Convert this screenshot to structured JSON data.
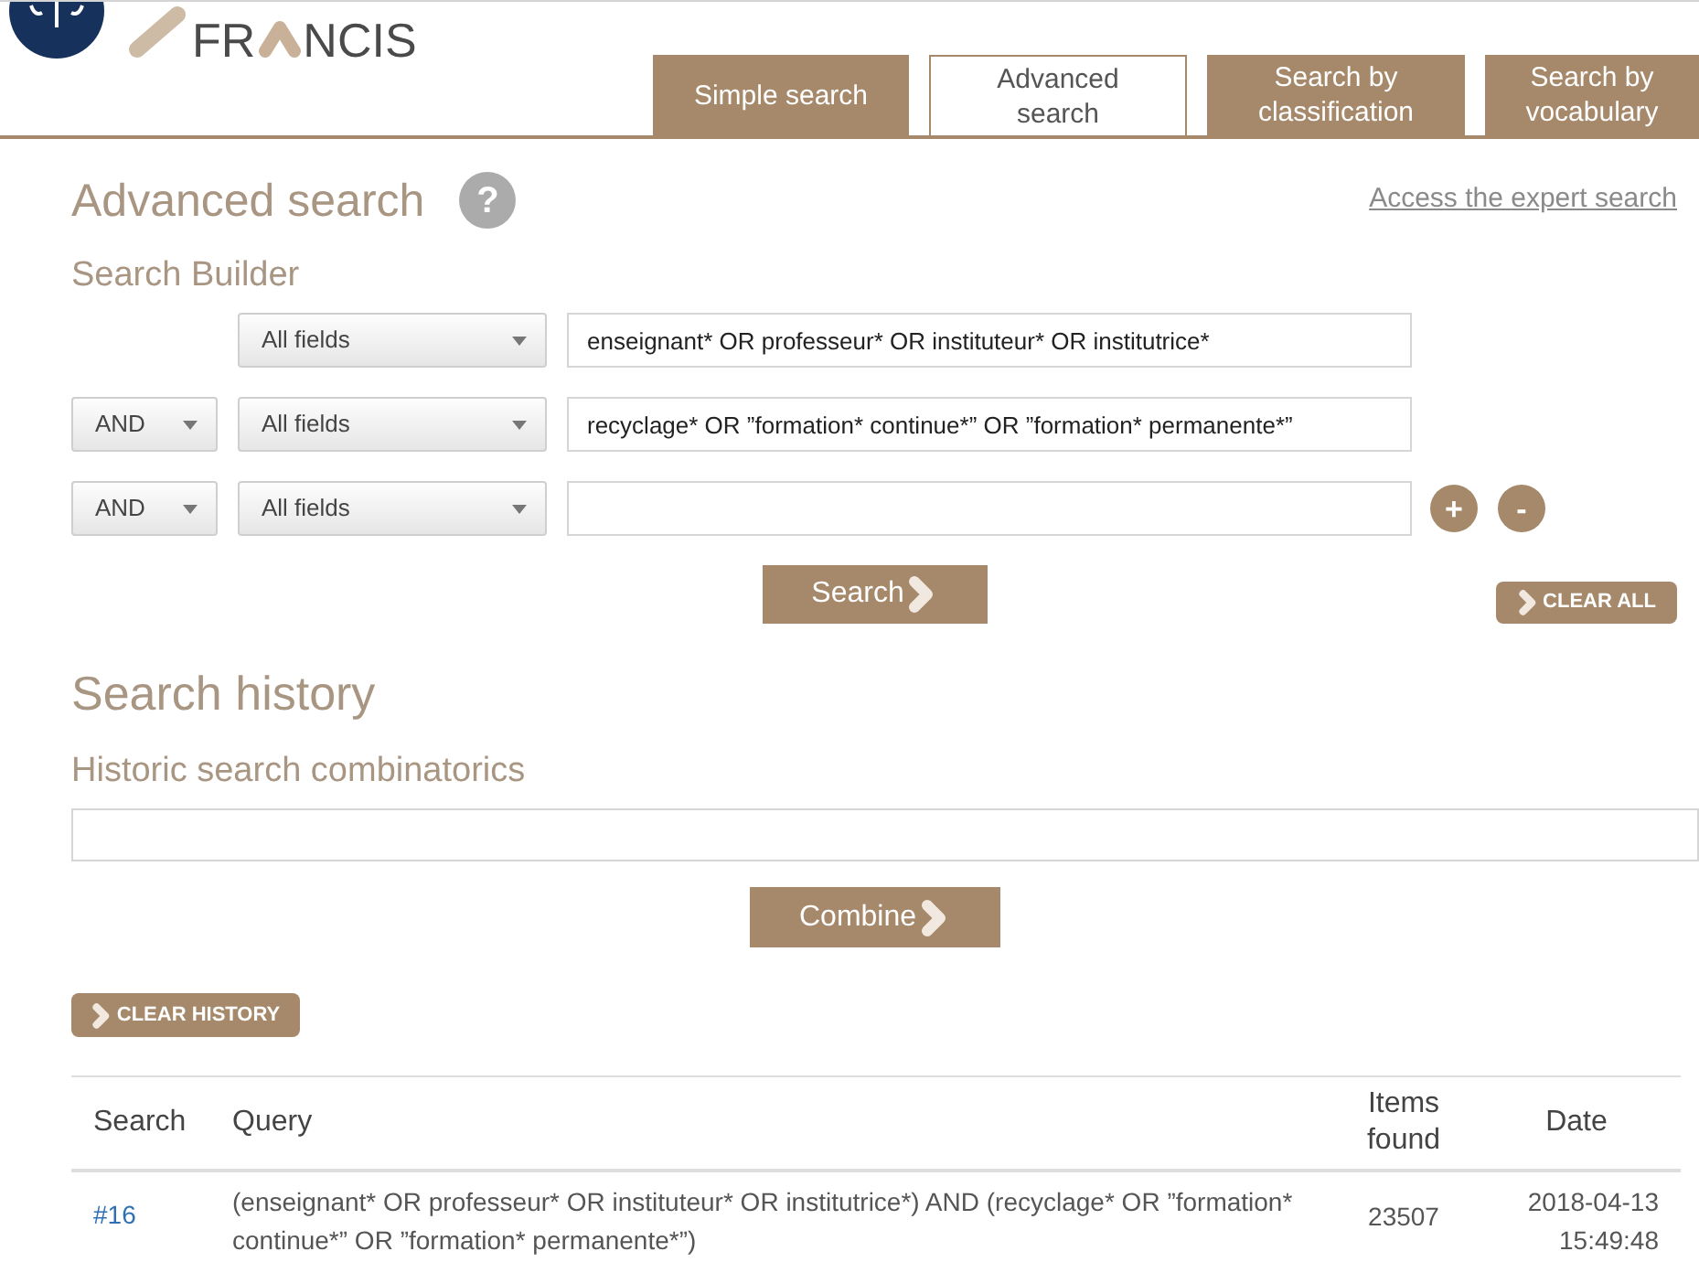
{
  "logo": {
    "text_before": "FR",
    "text_after": "NCIS"
  },
  "tabs": [
    {
      "label": "Simple search",
      "selected": false
    },
    {
      "label": "Advanced search",
      "selected": true
    },
    {
      "label": "Search by classification",
      "selected": false
    },
    {
      "label": "Search by vocabulary",
      "selected": false
    }
  ],
  "page": {
    "title": "Advanced search",
    "help": "?",
    "expert_link": "Access the expert search"
  },
  "builder": {
    "title": "Search Builder",
    "rows": [
      {
        "field": "All fields",
        "query": "enseignant* OR professeur* OR instituteur* OR institutrice*"
      },
      {
        "operator": "AND",
        "field": "All fields",
        "query": "recyclage* OR ”formation* continue*” OR ”formation* permanente*”"
      },
      {
        "operator": "AND",
        "field": "All fields"
      }
    ],
    "row_actions": [
      "+",
      "-"
    ],
    "search_button": "Search",
    "clear_all_button": "CLEAR ALL"
  },
  "history": {
    "title": "Search history",
    "combinatorics_label": "Historic search combinatorics",
    "combine_button": "Combine",
    "clear_history_button": "CLEAR HISTORY",
    "table": {
      "columns": [
        "Search",
        "Query",
        "Items found",
        "Date"
      ],
      "rows": [
        {
          "search": "#16",
          "query": "(enseignant* OR professeur* OR instituteur* OR institutrice*) AND (recyclage* OR ”formation* continue*” OR ”formation* permanente*”)",
          "items_found": "23507",
          "date": "2018-04-13 15:49:48"
        }
      ]
    }
  }
}
